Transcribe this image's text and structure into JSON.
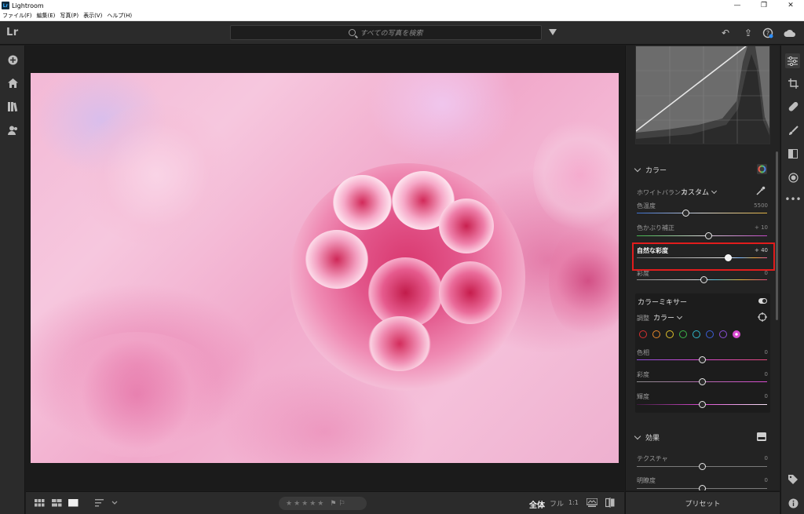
{
  "window": {
    "title": "Lightroom",
    "app_icon": "Lr",
    "controls": [
      "minimize-icon",
      "restore-icon",
      "close-icon"
    ]
  },
  "menu": [
    "ファイル(F)",
    "編集(E)",
    "写真(P)",
    "表示(V)",
    "ヘルプ(H)"
  ],
  "header": {
    "logo": "Lr",
    "search_placeholder": "すべての写真を検索",
    "icons": [
      "filter-icon",
      "undo-icon",
      "share-icon",
      "help-icon",
      "cloud-icon"
    ]
  },
  "left_nav": [
    "add-photos-icon",
    "home-icon",
    "library-icon",
    "people-icon"
  ],
  "bottom_toolbar": {
    "views": [
      "square-grid-icon",
      "photo-grid-icon",
      "detail-view-icon",
      "sort-icon"
    ],
    "rating": "★★★★★",
    "flags": [
      "pick-flag-icon",
      "reject-flag-icon"
    ],
    "zoom_options": [
      "全体",
      "フル",
      "1:1"
    ],
    "right_icons": [
      "compare-icon",
      "before-after-icon"
    ]
  },
  "color_panel": {
    "title": "カラー",
    "white_balance_label": "ホワイトバランス",
    "white_balance_value": "カスタム",
    "sliders": [
      {
        "label": "色温度",
        "value": "5500"
      },
      {
        "label": "色かぶり補正",
        "value": "+ 10"
      },
      {
        "label": "自然な彩度",
        "value": "+ 40"
      },
      {
        "label": "彩度",
        "value": "0"
      }
    ]
  },
  "color_mixer": {
    "title": "カラーミキサー",
    "adjust_label": "調整",
    "adjust_value": "カラー",
    "swatches": [
      "#e03030",
      "#e8882a",
      "#e8c52a",
      "#3cb64a",
      "#2fb7c9",
      "#3b5fd8",
      "#8c4fd8",
      "#d94bd0"
    ],
    "sliders": [
      {
        "label": "色相",
        "value": "0"
      },
      {
        "label": "彩度",
        "value": "0"
      },
      {
        "label": "輝度",
        "value": "0"
      }
    ]
  },
  "effects_panel": {
    "title": "効果",
    "sliders": [
      {
        "label": "テクスチャ",
        "value": "0"
      },
      {
        "label": "明瞭度",
        "value": "0"
      }
    ]
  },
  "preset_label": "プリセット",
  "tool_strip": [
    "edit-sliders-icon",
    "crop-icon",
    "healing-icon",
    "brush-icon",
    "gradient-icon",
    "radial-icon",
    "more-icon",
    "tag-icon",
    "info-icon"
  ],
  "colors": {
    "highlight": "#e11c1c",
    "panel_bg": "#232323",
    "chrome_bg": "#2b2b2b"
  }
}
